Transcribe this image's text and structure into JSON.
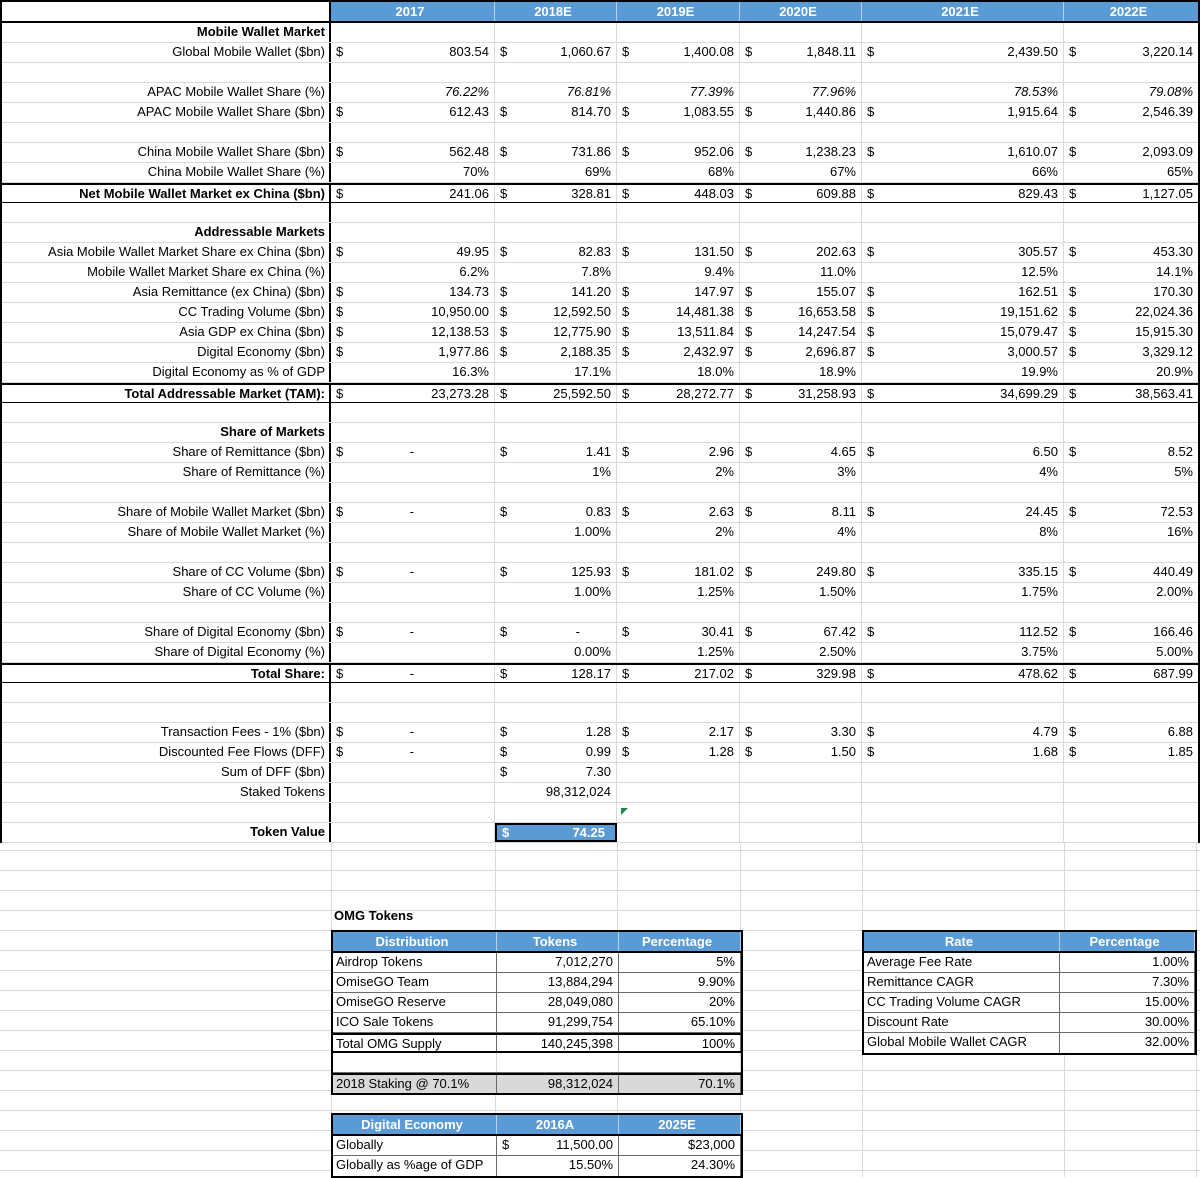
{
  "colors": {
    "header_blue": "#5b9bd5",
    "staking_gray": "#d9d9d9",
    "gridline": "#d9d9d9",
    "border_black": "#000000",
    "green_flag": "#1e8a3c"
  },
  "labels": {
    "omg_tokens": "OMG Tokens"
  },
  "token_value": {
    "currency": "$",
    "value": "74.25"
  },
  "sheet": {
    "year_headers": [
      "2017",
      "2018E",
      "2019E",
      "2020E",
      "2021E",
      "2022E"
    ],
    "rows": [
      {
        "l": "Mobile Wallet Market",
        "b": 1
      },
      {
        "l": "Global Mobile Wallet ($bn)",
        "c": [
          "$|803.54",
          "$|1,060.67",
          "$|1,400.08",
          "$|1,848.11",
          "$|2,439.50",
          "$|3,220.14"
        ]
      },
      {},
      {
        "l": "APAC Mobile Wallet Share (%)",
        "i": 1,
        "c": [
          "76.22%",
          "76.81%",
          "77.39%",
          "77.96%",
          "78.53%",
          "79.08%"
        ]
      },
      {
        "l": "APAC Mobile Wallet  Share ($bn)",
        "c": [
          "$|612.43",
          "$|814.70",
          "$|1,083.55",
          "$|1,440.86",
          "$|1,915.64",
          "$|2,546.39"
        ]
      },
      {},
      {
        "l": "China Mobile Wallet Share ($bn)",
        "c": [
          "$|562.48",
          "$|731.86",
          "$|952.06",
          "$|1,238.23",
          "$|1,610.07",
          "$|2,093.09"
        ]
      },
      {
        "l": "China Mobile Wallet Share (%)",
        "c": [
          "70%",
          "69%",
          "68%",
          "67%",
          "66%",
          "65%"
        ]
      },
      {
        "l": "Net Mobile Wallet Market ex China ($bn)",
        "b": 1,
        "t": 1,
        "c": [
          "$|241.06",
          "$|328.81",
          "$|448.03",
          "$|609.88",
          "$|829.43",
          "$|1,127.05"
        ]
      },
      {},
      {
        "l": "Addressable Markets",
        "b": 1
      },
      {
        "l": "Asia Mobile Wallet Market Share ex China ($bn)",
        "c": [
          "$|49.95",
          "$|82.83",
          "$|131.50",
          "$|202.63",
          "$|305.57",
          "$|453.30"
        ]
      },
      {
        "l": "Mobile Wallet Market Share ex China (%)",
        "c": [
          "6.2%",
          "7.8%",
          "9.4%",
          "11.0%",
          "12.5%",
          "14.1%"
        ]
      },
      {
        "l": "Asia  Remittance (ex China) ($bn)",
        "c": [
          "$|134.73",
          "$|141.20",
          "$|147.97",
          "$|155.07",
          "$|162.51",
          "$|170.30"
        ]
      },
      {
        "l": "CC Trading Volume ($bn)",
        "c": [
          "$|10,950.00",
          "$|12,592.50",
          "$|14,481.38",
          "$|16,653.58",
          "$|19,151.62",
          "$|22,024.36"
        ]
      },
      {
        "l": "Asia GDP ex China ($bn)",
        "c": [
          "$|12,138.53",
          "$|12,775.90",
          "$|13,511.84",
          "$|14,247.54",
          "$|15,079.47",
          "$|15,915.30"
        ]
      },
      {
        "l": "Digital Economy ($bn)",
        "c": [
          "$|1,977.86",
          "$|2,188.35",
          "$|2,432.97",
          "$|2,696.87",
          "$|3,000.57",
          "$|3,329.12"
        ]
      },
      {
        "l": "Digital Economy as % of GDP",
        "c": [
          "16.3%",
          "17.1%",
          "18.0%",
          "18.9%",
          "19.9%",
          "20.9%"
        ]
      },
      {
        "l": "Total Addressable Market (TAM):",
        "b": 1,
        "t": 1,
        "c": [
          "$|23,273.28",
          "$|25,592.50",
          "$|28,272.77",
          "$|31,258.93",
          "$|34,699.29",
          "$|38,563.41"
        ]
      },
      {},
      {
        "l": "Share of Markets",
        "b": 1
      },
      {
        "l": "Share of Remittance ($bn)",
        "c": [
          "$|-",
          "$|1.41",
          "$|2.96",
          "$|4.65",
          "$|6.50",
          "$|8.52"
        ]
      },
      {
        "l": "Share of Remittance (%)",
        "c": [
          "",
          "1%",
          "2%",
          "3%",
          "4%",
          "5%"
        ]
      },
      {},
      {
        "l": "Share of Mobile Wallet Market ($bn)",
        "c": [
          "$|-",
          "$|0.83",
          "$|2.63",
          "$|8.11",
          "$|24.45",
          "$|72.53"
        ]
      },
      {
        "l": "Share of Mobile Wallet Market (%)",
        "c": [
          "",
          "1.00%",
          "2%",
          "4%",
          "8%",
          "16%"
        ]
      },
      {},
      {
        "l": "Share of CC Volume ($bn)",
        "c": [
          "$|-",
          "$|125.93",
          "$|181.02",
          "$|249.80",
          "$|335.15",
          "$|440.49"
        ]
      },
      {
        "l": "Share of CC Volume (%)",
        "c": [
          "",
          "1.00%",
          "1.25%",
          "1.50%",
          "1.75%",
          "2.00%"
        ]
      },
      {},
      {
        "l": "Share of Digital Economy ($bn)",
        "c": [
          "$|-",
          "$|-",
          "$|30.41",
          "$|67.42",
          "$|112.52",
          "$|166.46"
        ]
      },
      {
        "l": "Share of Digital Economy (%)",
        "c": [
          "",
          "0.00%",
          "1.25%",
          "2.50%",
          "3.75%",
          "5.00%"
        ]
      },
      {
        "l": "Total Share:",
        "b": 1,
        "t": 1,
        "c": [
          "$|-",
          "$|128.17",
          "$|217.02",
          "$|329.98",
          "$|478.62",
          "$|687.99"
        ]
      },
      {},
      {},
      {
        "l": "Transaction Fees - 1% ($bn)",
        "c": [
          "$|-",
          "$|1.28",
          "$|2.17",
          "$|3.30",
          "$|4.79",
          "$|6.88"
        ]
      },
      {
        "l": "Discounted Fee Flows (DFF)",
        "c": [
          "$|-",
          "$|0.99",
          "$|1.28",
          "$|1.50",
          "$|1.68",
          "$|1.85"
        ]
      },
      {
        "l": "Sum of DFF ($bn)",
        "c": [
          "",
          "$|7.30",
          "",
          "",
          "",
          ""
        ]
      },
      {
        "l": "Staked Tokens",
        "c": [
          "",
          "98,312,024",
          "",
          "",
          "",
          ""
        ]
      },
      {},
      {
        "l": "Token Value",
        "b": 1,
        "tv": 1
      }
    ]
  },
  "omg_table": {
    "headers": [
      "Distribution",
      "Tokens",
      "Percentage"
    ],
    "rows": [
      {
        "cells": [
          "Airdrop Tokens",
          "7,012,270",
          "5%"
        ]
      },
      {
        "cells": [
          "OmiseGO Team",
          "13,884,294",
          "9.90%"
        ]
      },
      {
        "cells": [
          "OmiseGO Reserve",
          "28,049,080",
          "20%"
        ]
      },
      {
        "cells": [
          "ICO Sale Tokens",
          "91,299,754",
          "65.10%"
        ]
      },
      {
        "cells": [
          "Total OMG Supply",
          "140,245,398",
          "100%"
        ],
        "cls": "total"
      },
      {
        "cells": [
          "",
          "",
          ""
        ],
        "cls": "spacer"
      },
      {
        "cells": [
          "2018 Staking @ 70.1%",
          "98,312,024",
          "70.1%"
        ],
        "cls": "staking"
      }
    ]
  },
  "rate_table": {
    "headers": [
      "Rate",
      "Percentage"
    ],
    "rows": [
      {
        "cells": [
          "Average Fee Rate",
          "1.00%"
        ]
      },
      {
        "cells": [
          "Remittance CAGR",
          "7.30%"
        ]
      },
      {
        "cells": [
          "CC Trading Volume CAGR",
          "15.00%"
        ]
      },
      {
        "cells": [
          "Discount Rate",
          "30.00%"
        ]
      },
      {
        "cells": [
          "Global Mobile Wallet CAGR",
          "32.00%"
        ]
      }
    ]
  },
  "digital_table": {
    "headers": [
      "Digital Economy",
      "2016A",
      "2025E"
    ],
    "rows": [
      {
        "cells": [
          "Globally",
          "$|11,500.00",
          "$23,000"
        ]
      },
      {
        "cells": [
          "Globally as %age of GDP",
          "15.50%",
          "24.30%"
        ]
      }
    ]
  }
}
